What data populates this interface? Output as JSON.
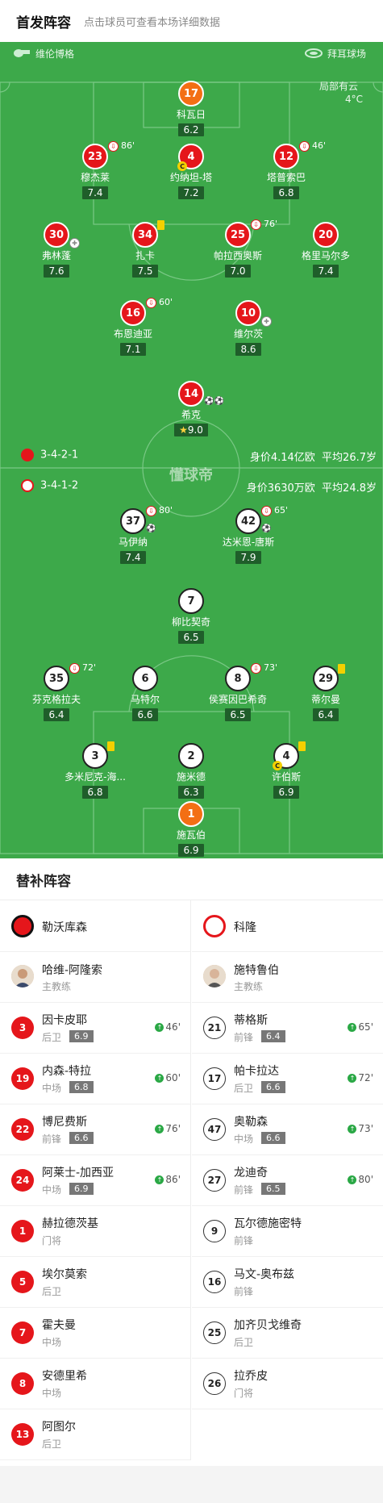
{
  "header": {
    "title": "首发阵容",
    "subtitle": "点击球员可查看本场详细数据"
  },
  "match_info": {
    "referee": "维伦博格",
    "stadium": "拜耳球场",
    "weather": "局部有云",
    "temperature": "4°C"
  },
  "home_team": {
    "name": "勒沃库森",
    "formation": "3-4-2-1",
    "value": "身价4.14亿欧",
    "avg_age": "平均26.7岁",
    "color": "#e5161b"
  },
  "away_team": {
    "name": "科隆",
    "formation": "3-4-1-2",
    "value": "身价3630万欧",
    "avg_age": "平均24.8岁",
    "color": "#ffffff"
  },
  "home_players": [
    {
      "number": "17",
      "name": "科瓦日",
      "rating": "6.2"
    },
    {
      "number": "23",
      "name": "穆杰莱",
      "rating": "7.4",
      "sub_time": "86'"
    },
    {
      "number": "4",
      "name": "约纳坦-塔",
      "rating": "7.2"
    },
    {
      "number": "12",
      "name": "塔普索巴",
      "rating": "6.8",
      "sub_time": "46'"
    },
    {
      "number": "30",
      "name": "弗林蓬",
      "rating": "7.6"
    },
    {
      "number": "34",
      "name": "扎卡",
      "rating": "7.5"
    },
    {
      "number": "25",
      "name": "帕拉西奥斯",
      "rating": "7.0",
      "sub_time": "76'"
    },
    {
      "number": "20",
      "name": "格里马尔多",
      "rating": "7.4"
    },
    {
      "number": "16",
      "name": "布恩迪亚",
      "rating": "7.1",
      "sub_time": "60'"
    },
    {
      "number": "10",
      "name": "维尔茨",
      "rating": "8.6"
    },
    {
      "number": "14",
      "name": "希克",
      "rating": "9.0"
    }
  ],
  "away_players": [
    {
      "number": "37",
      "name": "马伊纳",
      "rating": "7.4",
      "sub_time": "80'"
    },
    {
      "number": "42",
      "name": "达米恩-唐斯",
      "rating": "7.9",
      "sub_time": "65'"
    },
    {
      "number": "7",
      "name": "柳比契奇",
      "rating": "6.5"
    },
    {
      "number": "35",
      "name": "芬克格拉夫",
      "rating": "6.4",
      "sub_time": "72'"
    },
    {
      "number": "6",
      "name": "马特尔",
      "rating": "6.6"
    },
    {
      "number": "8",
      "name": "侯赛因巴希奇",
      "rating": "6.5",
      "sub_time": "73'"
    },
    {
      "number": "29",
      "name": "蒂尔曼",
      "rating": "6.4"
    },
    {
      "number": "3",
      "name": "多米尼克-海...",
      "rating": "6.8"
    },
    {
      "number": "2",
      "name": "施米德",
      "rating": "6.3"
    },
    {
      "number": "4",
      "name": "许伯斯",
      "rating": "6.9"
    },
    {
      "number": "1",
      "name": "施瓦伯",
      "rating": "6.9"
    }
  ],
  "watermark": "懂球帝",
  "subs": {
    "title": "替补阵容",
    "coach_label": "主教练",
    "home_coach": "哈维-阿隆索",
    "away_coach": "施特鲁伯",
    "home": [
      {
        "number": "3",
        "name": "因卡皮耶",
        "pos": "后卫",
        "rating": "6.9",
        "time": "46'"
      },
      {
        "number": "19",
        "name": "内森-特拉",
        "pos": "中场",
        "rating": "6.8",
        "time": "60'"
      },
      {
        "number": "22",
        "name": "博尼费斯",
        "pos": "前锋",
        "rating": "6.6",
        "time": "76'"
      },
      {
        "number": "24",
        "name": "阿莱士-加西亚",
        "pos": "中场",
        "rating": "6.9",
        "time": "86'"
      },
      {
        "number": "1",
        "name": "赫拉德茨基",
        "pos": "门将"
      },
      {
        "number": "5",
        "name": "埃尔莫索",
        "pos": "后卫"
      },
      {
        "number": "7",
        "name": "霍夫曼",
        "pos": "中场"
      },
      {
        "number": "8",
        "name": "安德里希",
        "pos": "中场"
      },
      {
        "number": "13",
        "name": "阿图尔",
        "pos": "后卫"
      }
    ],
    "away": [
      {
        "number": "21",
        "name": "蒂格斯",
        "pos": "前锋",
        "rating": "6.4",
        "time": "65'"
      },
      {
        "number": "17",
        "name": "帕卡拉达",
        "pos": "后卫",
        "rating": "6.6",
        "time": "72'"
      },
      {
        "number": "47",
        "name": "奥勒森",
        "pos": "中场",
        "rating": "6.6",
        "time": "73'"
      },
      {
        "number": "27",
        "name": "龙迪奇",
        "pos": "前锋",
        "rating": "6.5",
        "time": "80'"
      },
      {
        "number": "9",
        "name": "瓦尔德施密特",
        "pos": "前锋"
      },
      {
        "number": "16",
        "name": "马文-奥布兹",
        "pos": "前锋"
      },
      {
        "number": "25",
        "name": "加齐贝戈维奇",
        "pos": "后卫"
      },
      {
        "number": "26",
        "name": "拉乔皮",
        "pos": "门将"
      }
    ]
  }
}
